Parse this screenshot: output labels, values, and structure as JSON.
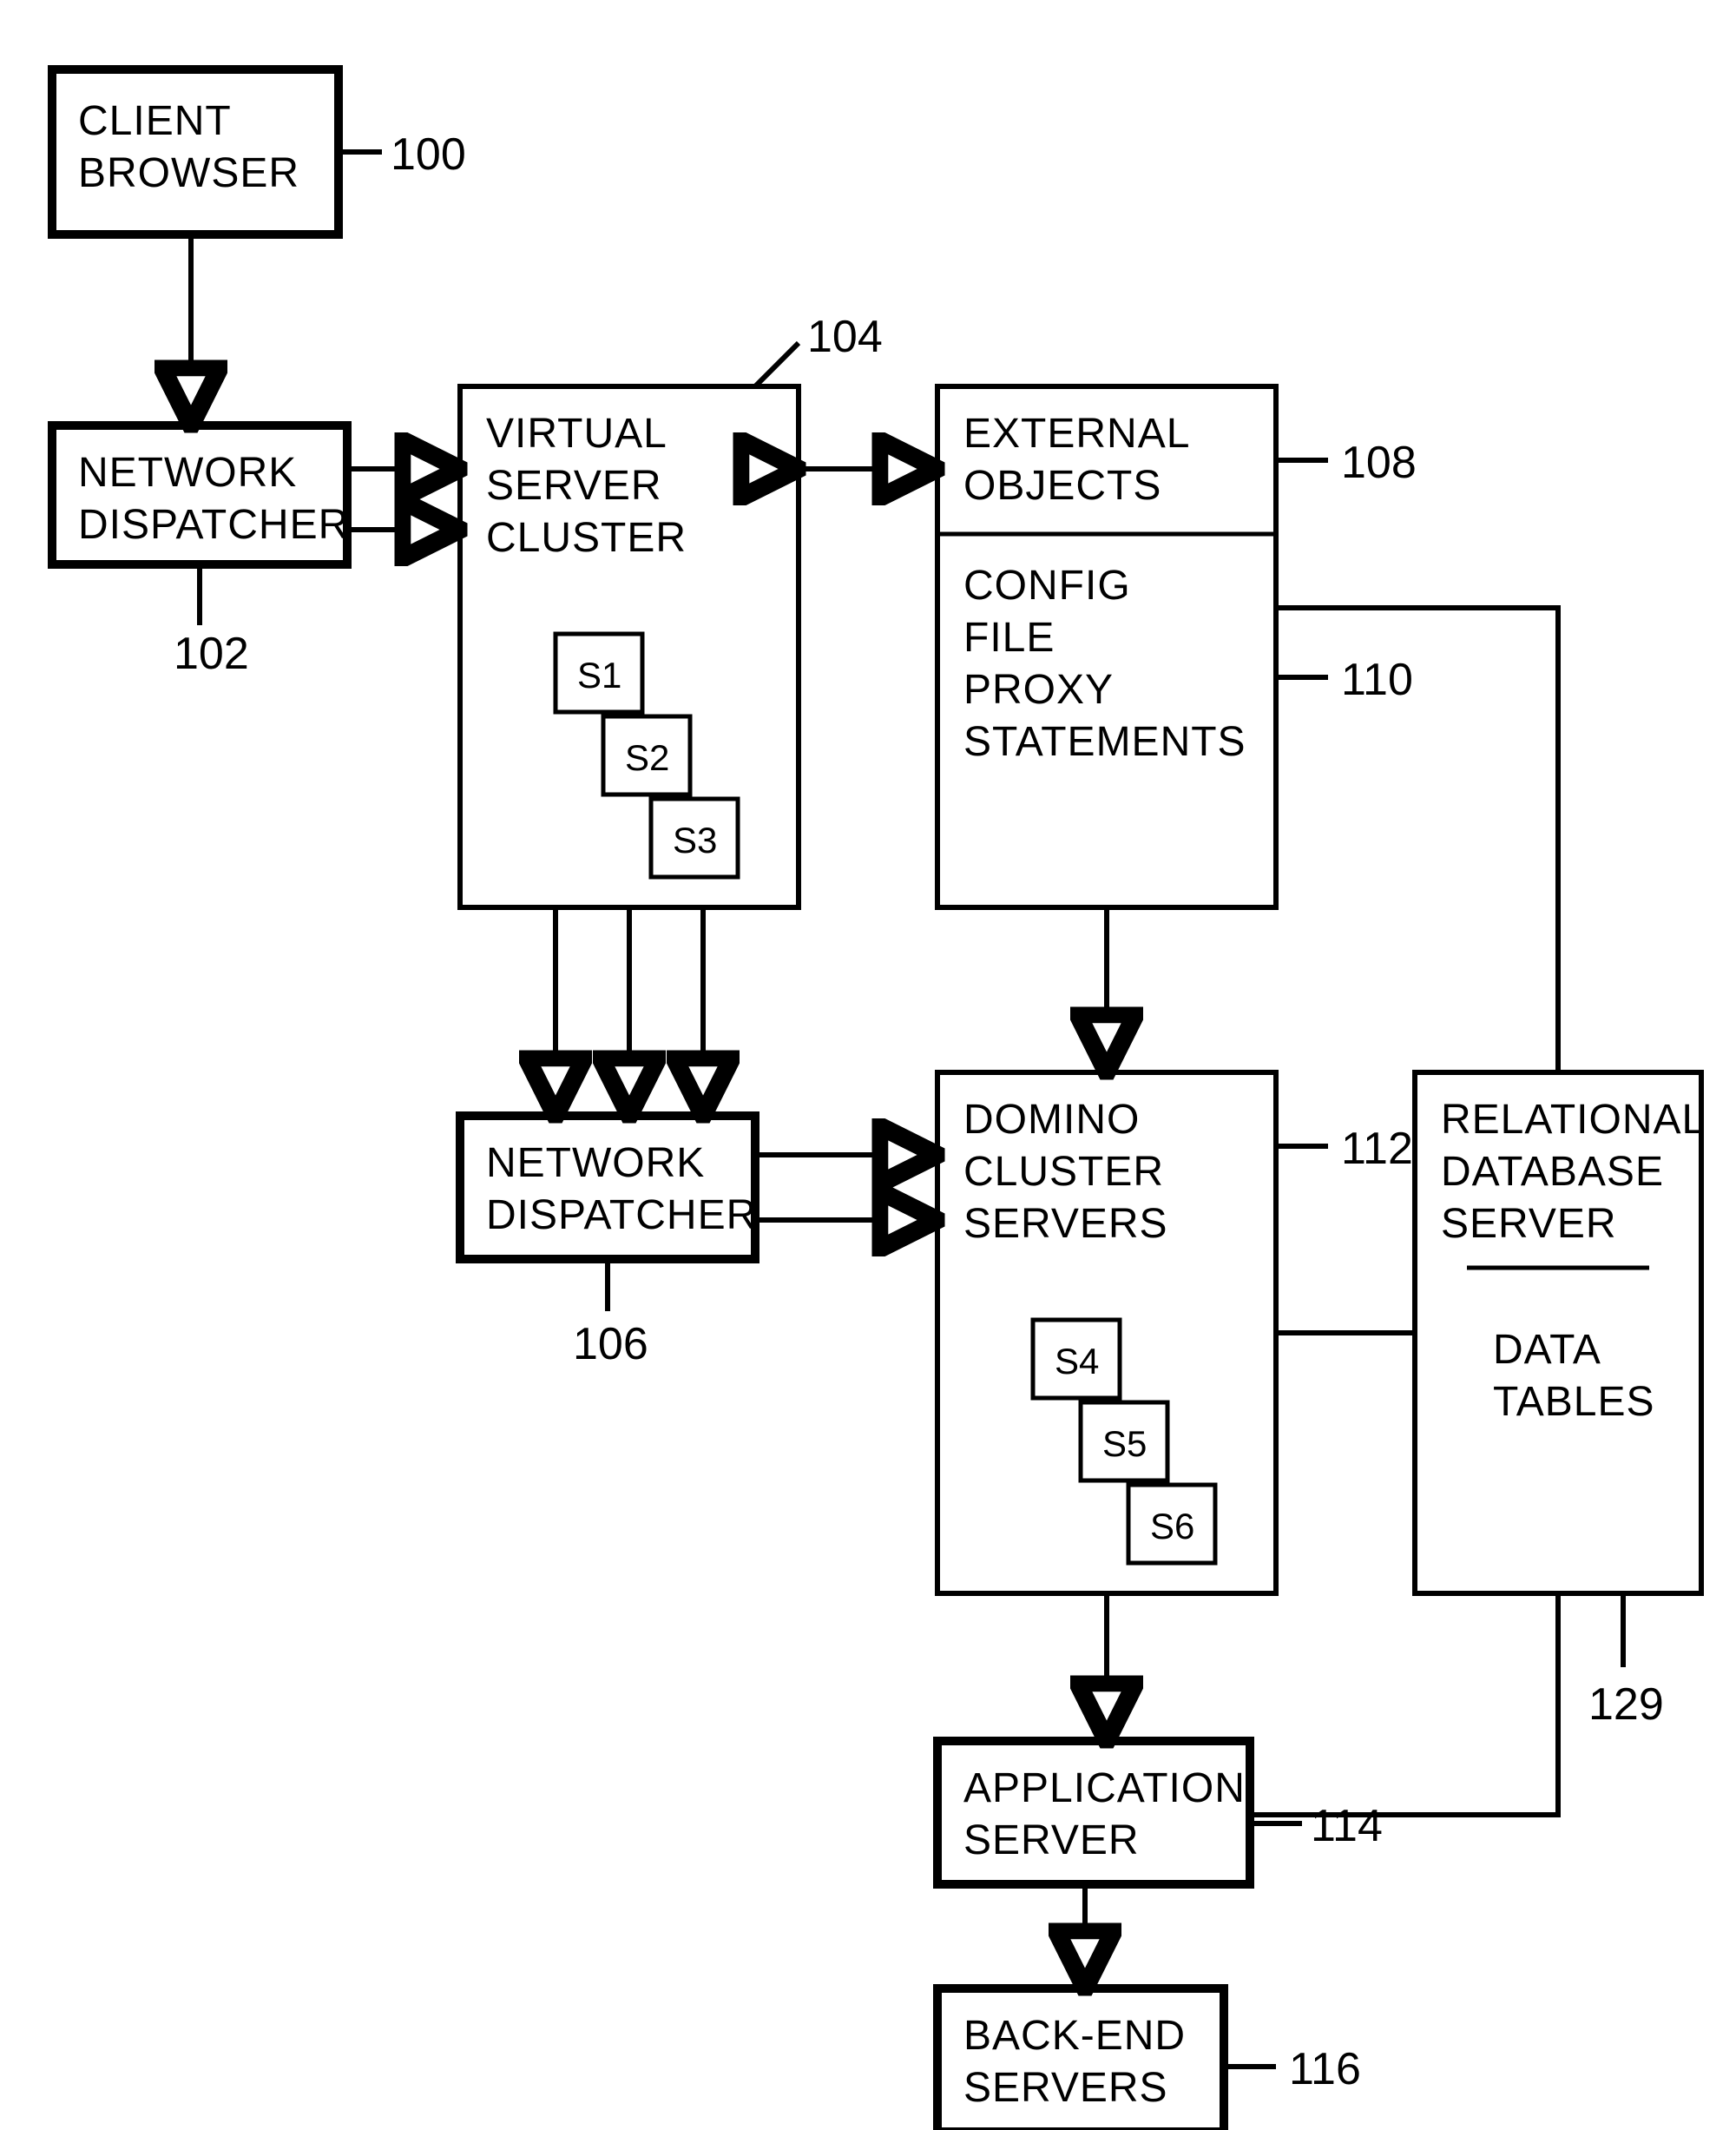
{
  "boxes": {
    "client_browser": {
      "l1": "CLIENT",
      "l2": "BROWSER",
      "ref": "100"
    },
    "network_dispatcher_1": {
      "l1": "NETWORK",
      "l2": "DISPATCHER",
      "ref": "102"
    },
    "virtual_server_cluster": {
      "l1": "VIRTUAL",
      "l2": "SERVER",
      "l3": "CLUSTER",
      "ref": "104",
      "s": [
        "S1",
        "S2",
        "S3"
      ]
    },
    "external_objects": {
      "l1": "EXTERNAL",
      "l2": "OBJECTS",
      "ref": "108"
    },
    "config_file": {
      "l1": "CONFIG",
      "l2": "FILE",
      "l3": "PROXY",
      "l4": "STATEMENTS",
      "ref": "110"
    },
    "network_dispatcher_2": {
      "l1": "NETWORK",
      "l2": "DISPATCHER",
      "ref": "106"
    },
    "domino_cluster": {
      "l1": "DOMINO",
      "l2": "CLUSTER",
      "l3": "SERVERS",
      "ref": "112",
      "s": [
        "S4",
        "S5",
        "S6"
      ]
    },
    "relational_db": {
      "l1": "RELATIONAL",
      "l2": "DATABASE",
      "l3": "SERVER",
      "sub1": "DATA",
      "sub2": "TABLES",
      "ref": "129"
    },
    "application_server": {
      "l1": "APPLICATION",
      "l2": "SERVER",
      "ref": "114"
    },
    "backend_servers": {
      "l1": "BACK-END",
      "l2": "SERVERS",
      "ref": "116"
    }
  }
}
